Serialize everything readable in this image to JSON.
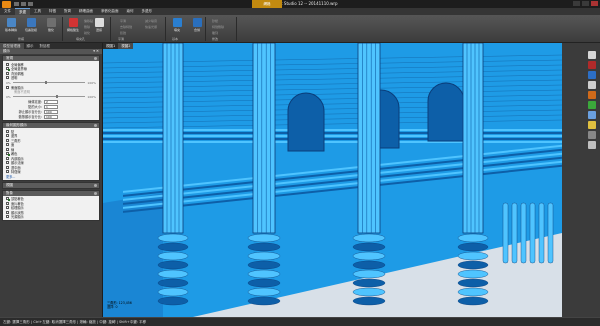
{
  "app": {
    "title": "Geomagic Studio 12 -- 20141110.wrp",
    "context_tab": "網格"
  },
  "tabs": [
    {
      "label": "文件",
      "active": false
    },
    {
      "label": "多邊",
      "active": true
    },
    {
      "label": "工具",
      "active": false
    },
    {
      "label": "特徵",
      "active": false
    },
    {
      "label": "對齊",
      "active": false
    },
    {
      "label": "精確曲面",
      "active": false
    },
    {
      "label": "參數化曲面",
      "active": false
    },
    {
      "label": "幾何",
      "active": false
    },
    {
      "label": "多邊形",
      "active": false
    }
  ],
  "ribbon": {
    "buttons": [
      {
        "label": "版本轉換",
        "color": "#4a86c5",
        "name": "version-convert"
      },
      {
        "label": "包裹建模",
        "color": "#3b77bd",
        "name": "wrap"
      },
      {
        "label": "簡化",
        "color": "#6f6f6f",
        "name": "simplify"
      },
      {
        "label": "網格醫生",
        "color": "#d23434",
        "name": "mesh-doctor"
      },
      {
        "label": "選擇",
        "color": "#dddddd",
        "name": "select"
      },
      {
        "label": "填充",
        "color": "#2a7fd1",
        "name": "fill"
      },
      {
        "label": "合併",
        "color": "#2a6fbd",
        "name": "merge"
      }
    ],
    "small_items": [
      "偏移點",
      "刪除",
      "銳化",
      "平滑",
      "去除特徵",
      "鬆弛",
      "減少噪音",
      "快速光順",
      "砂紙",
      "特徵刪除",
      "雕刻"
    ],
    "groups": [
      "修補",
      "填充孔",
      "平滑",
      "基本",
      "修改"
    ]
  },
  "left_panel": {
    "tabs": [
      {
        "label": "模型管理器",
        "active": true
      },
      {
        "label": "顯示",
        "active": false
      },
      {
        "label": "對話框",
        "active": false
      }
    ],
    "header": "顯示",
    "sections": [
      {
        "title": "常規",
        "checks": [
          {
            "label": "全局偏移",
            "checked": false
          },
          {
            "label": "全局邊界線",
            "checked": true
          },
          {
            "label": "背景網格",
            "checked": false
          },
          {
            "label": "透明",
            "checked": false
          }
        ],
        "slider_a": {
          "min": "0%",
          "max": "100%",
          "value_pct": 45
        },
        "checks2": [
          {
            "label": "側面顯示",
            "checked": false
          }
        ],
        "subhdr": "側面不透明",
        "slider_b": {
          "min": "0%",
          "max": "100%",
          "value_pct": 60
        },
        "numbers": [
          {
            "label": "線條寬度:",
            "value": "2"
          },
          {
            "label": "點的大小:",
            "value": "1"
          },
          {
            "label": "靜止顯示百分比:",
            "value": "100"
          },
          {
            "label": "動態顯示百分比:",
            "value": "100"
          }
        ]
      },
      {
        "title": "幾何圖形顯示",
        "checks": [
          {
            "label": "點",
            "checked": false
          },
          {
            "label": "邊界",
            "checked": false
          },
          {
            "label": "三角形",
            "checked": false
          },
          {
            "label": "面",
            "checked": false
          },
          {
            "label": "線",
            "checked": false
          },
          {
            "label": "著色",
            "checked": true
          },
          {
            "label": "內部顯示",
            "checked": false
          },
          {
            "label": "顯示法線",
            "checked": false
          },
          {
            "label": "選中面",
            "checked": false
          },
          {
            "label": "特徵線",
            "checked": false
          }
        ],
        "more": "更多..."
      },
      {
        "title": "視圖",
        "checks": []
      },
      {
        "title": "對象",
        "checks": [
          {
            "label": "頂點著色",
            "checked": true
          },
          {
            "label": "面片著色",
            "checked": false
          },
          {
            "label": "紋理顯示",
            "checked": false
          },
          {
            "label": "顯示狀態",
            "checked": false
          },
          {
            "label": "光源顯示",
            "checked": false
          }
        ]
      }
    ]
  },
  "viewport": {
    "tabs": [
      {
        "label": "視圖1",
        "active": true
      },
      {
        "label": "視圖2",
        "active": false
      }
    ],
    "coords": [
      "三角形: 123,456",
      "選擇: 0"
    ],
    "colors": {
      "model": "#1e9be6",
      "highlight": "#4fc4ff",
      "shadow": "#0d5fa8",
      "edge": "#0a3d7a",
      "floor": "#d8e0e8"
    }
  },
  "right_toolbar": {
    "tools": [
      "#d7d7d7",
      "#b02a2a",
      "#2c6fc6",
      "#d0d0d0",
      "#d06a1a",
      "#3ba83b",
      "#6aa0e0",
      "#e0c040",
      "#888888",
      "#c0c0c0"
    ]
  },
  "status": "左鍵: 選擇三角形 | Ctrl+左鍵: 取消選擇三角形 | 滾輪: 縮放 | 中鍵: 旋轉 | Shift+中鍵: 平移"
}
